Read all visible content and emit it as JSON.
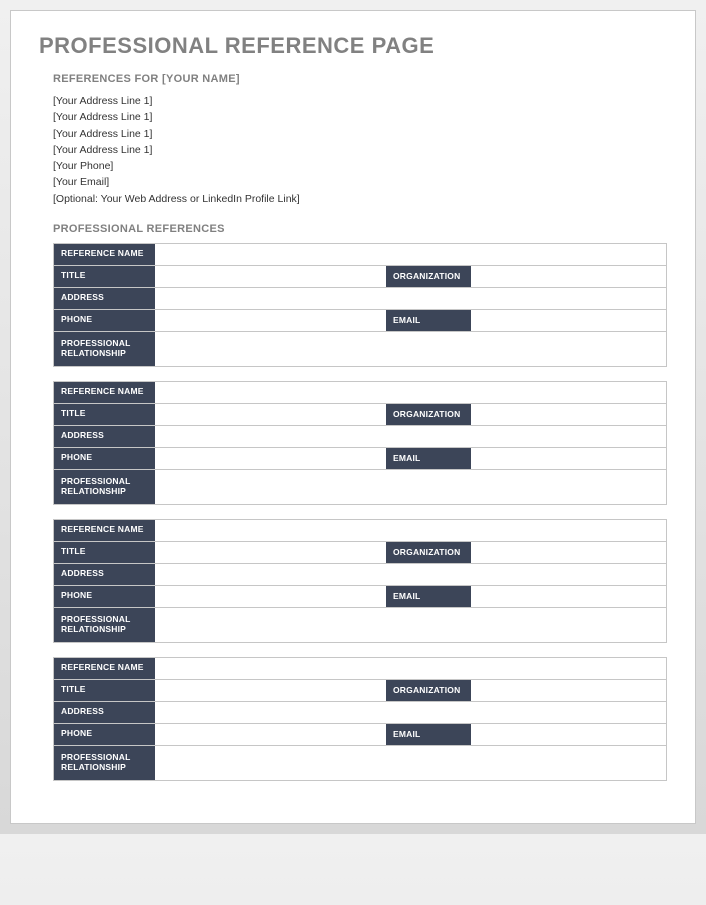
{
  "title": "PROFESSIONAL REFERENCE PAGE",
  "references_for_label": "REFERENCES FOR [YOUR NAME]",
  "info_lines": [
    "[Your Address Line 1]",
    "[Your Address Line 1]",
    "[Your Address Line 1]",
    "[Your Address Line 1]",
    "[Your Phone]",
    "[Your Email]",
    "[Optional: Your Web Address or LinkedIn Profile Link]"
  ],
  "section_heading": "PROFESSIONAL REFERENCES",
  "field_labels": {
    "reference_name": "REFERENCE NAME",
    "title": "TITLE",
    "organization": "ORGANIZATION",
    "address": "ADDRESS",
    "phone": "PHONE",
    "email": "EMAIL",
    "professional_relationship": "PROFESSIONAL RELATIONSHIP"
  },
  "references": [
    {
      "reference_name": "",
      "title": "",
      "organization": "",
      "address": "",
      "phone": "",
      "email": "",
      "professional_relationship": ""
    },
    {
      "reference_name": "",
      "title": "",
      "organization": "",
      "address": "",
      "phone": "",
      "email": "",
      "professional_relationship": ""
    },
    {
      "reference_name": "",
      "title": "",
      "organization": "",
      "address": "",
      "phone": "",
      "email": "",
      "professional_relationship": ""
    },
    {
      "reference_name": "",
      "title": "",
      "organization": "",
      "address": "",
      "phone": "",
      "email": "",
      "professional_relationship": ""
    }
  ]
}
